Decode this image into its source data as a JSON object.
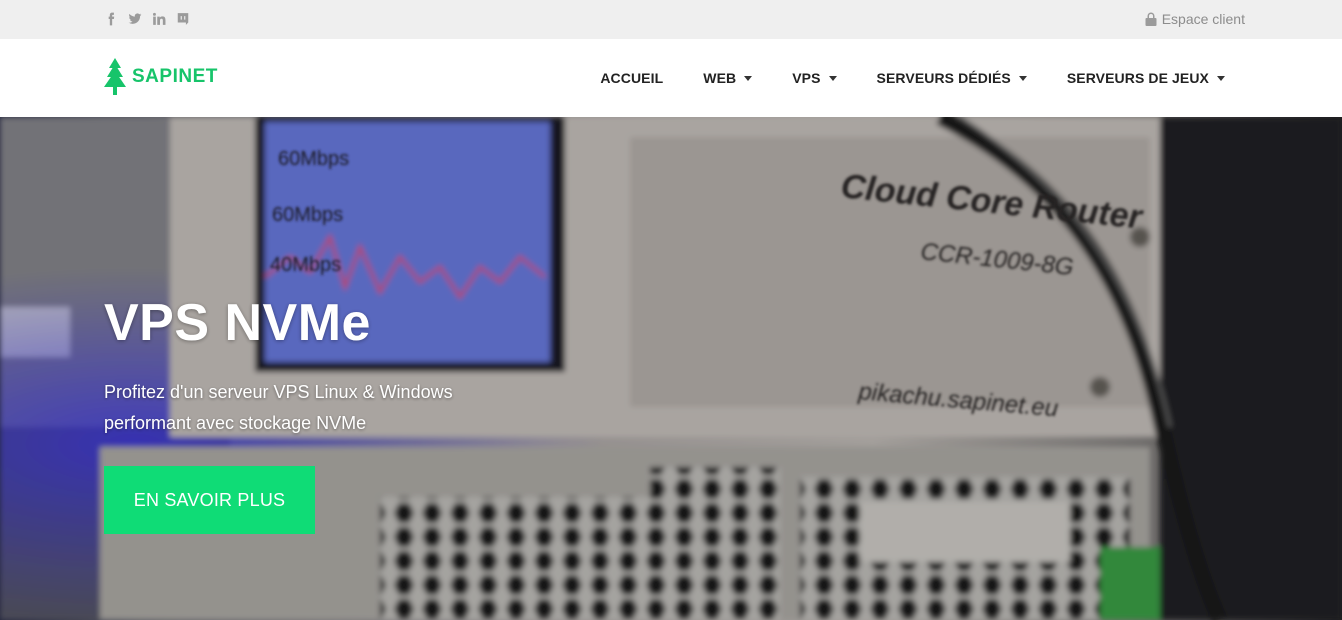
{
  "topbar": {
    "social_icons": [
      "facebook-icon",
      "twitter-icon",
      "linkedin-icon",
      "discord-icon"
    ],
    "client_link": "Espace client"
  },
  "brand": {
    "name": "SAPINET",
    "color": "#17c46a"
  },
  "nav": {
    "items": [
      {
        "label": "ACCUEIL",
        "dropdown": false
      },
      {
        "label": "WEB",
        "dropdown": true
      },
      {
        "label": "VPS",
        "dropdown": true
      },
      {
        "label": "SERVEURS DÉDIÉS",
        "dropdown": true
      },
      {
        "label": "SERVEURS DE JEUX",
        "dropdown": true
      }
    ]
  },
  "hero": {
    "title": "VPS NVMe",
    "subtitle": "Profitez d'un serveur VPS Linux & Windows performant avec stockage NVMe",
    "button_label": "EN SAVOIR PLUS",
    "button_color": "#0fdc76",
    "photo_texts": {
      "screen_line1": "60Mbps",
      "screen_line2": "60Mbps",
      "screen_line3": "40Mbps",
      "device_brand": "Cloud Core Router",
      "device_model": "CCR-1009-8G",
      "hostname": "pikachu.sapinet.eu"
    }
  }
}
